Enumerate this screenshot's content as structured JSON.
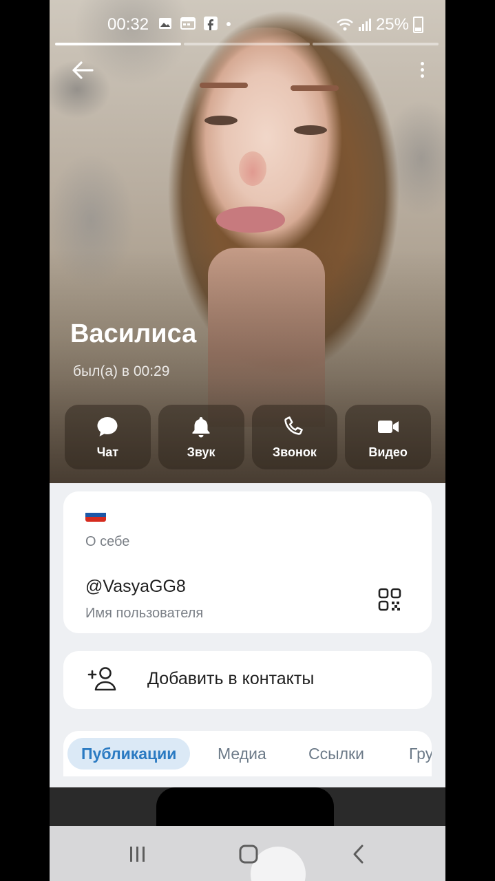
{
  "status_bar": {
    "time": "00:32",
    "battery": "25%",
    "notification_icons": [
      "image-icon",
      "calendar-icon",
      "facebook-icon",
      "dot-icon"
    ]
  },
  "profile": {
    "name": "Василиса",
    "last_seen": "был(а) в 00:29"
  },
  "actions": [
    {
      "label": "Чат",
      "icon": "chat-icon"
    },
    {
      "label": "Звук",
      "icon": "bell-icon"
    },
    {
      "label": "Звонок",
      "icon": "phone-icon"
    },
    {
      "label": "Видео",
      "icon": "video-icon"
    }
  ],
  "info": {
    "flag": "🇷🇺",
    "about_label": "О себе",
    "username": "@VasyaGG8",
    "username_label": "Имя пользователя"
  },
  "add_contact": {
    "label": "Добавить в контакты"
  },
  "tabs": [
    "Публикации",
    "Медиа",
    "Ссылки",
    "Гру"
  ],
  "active_tab": 0,
  "colors": {
    "accent": "#2a7ac2",
    "tab_active_bg": "#dbe9f6",
    "content_bg": "#eef0f3"
  }
}
